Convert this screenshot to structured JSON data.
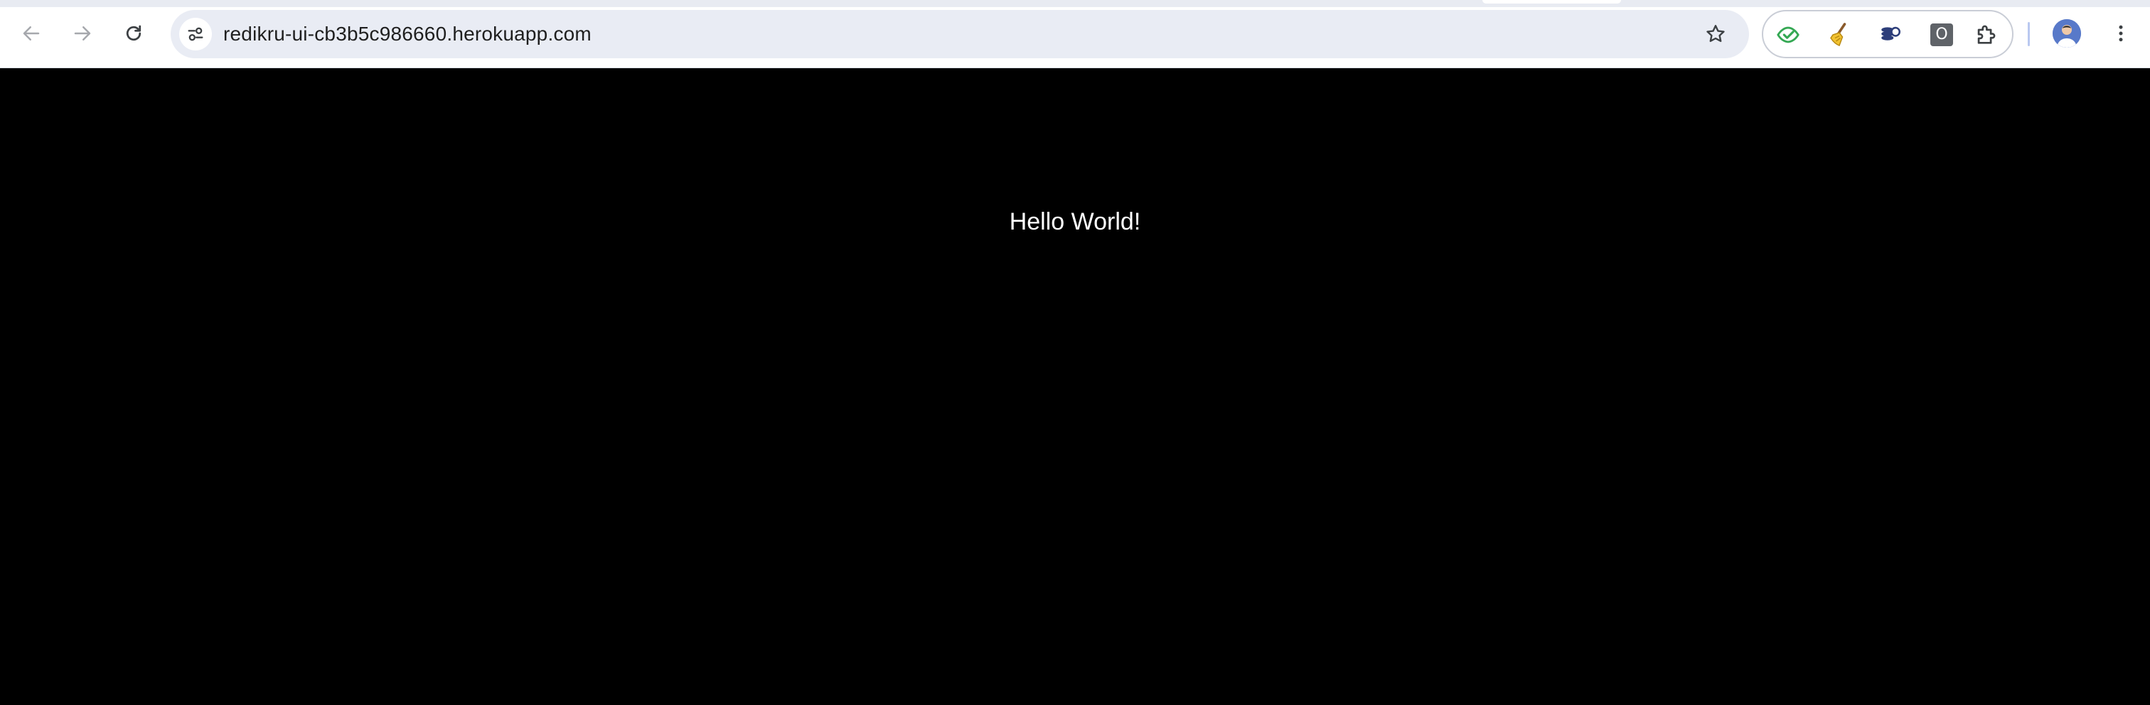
{
  "browser": {
    "url": "redikru-ui-cb3b5c986660.herokuapp.com",
    "icons": {
      "back": "arrow-left-icon",
      "forward": "arrow-right-icon",
      "reload": "reload-icon",
      "site_info": "tune-icon",
      "bookmark": "star-icon",
      "extensions": [
        "eye-check-extension-icon",
        "broom-extension-icon",
        "coins-extension-icon",
        "o-box-extension-icon",
        "puzzle-extensions-icon"
      ],
      "profile": "avatar",
      "menu": "kebab-menu-icon"
    },
    "colors": {
      "omnibox_bg": "#e9ecf4",
      "extension_green": "#34a853",
      "page_bg": "#000000",
      "page_text": "#ffffff"
    },
    "extension_badge_text": "O"
  },
  "page": {
    "message": "Hello World!"
  }
}
